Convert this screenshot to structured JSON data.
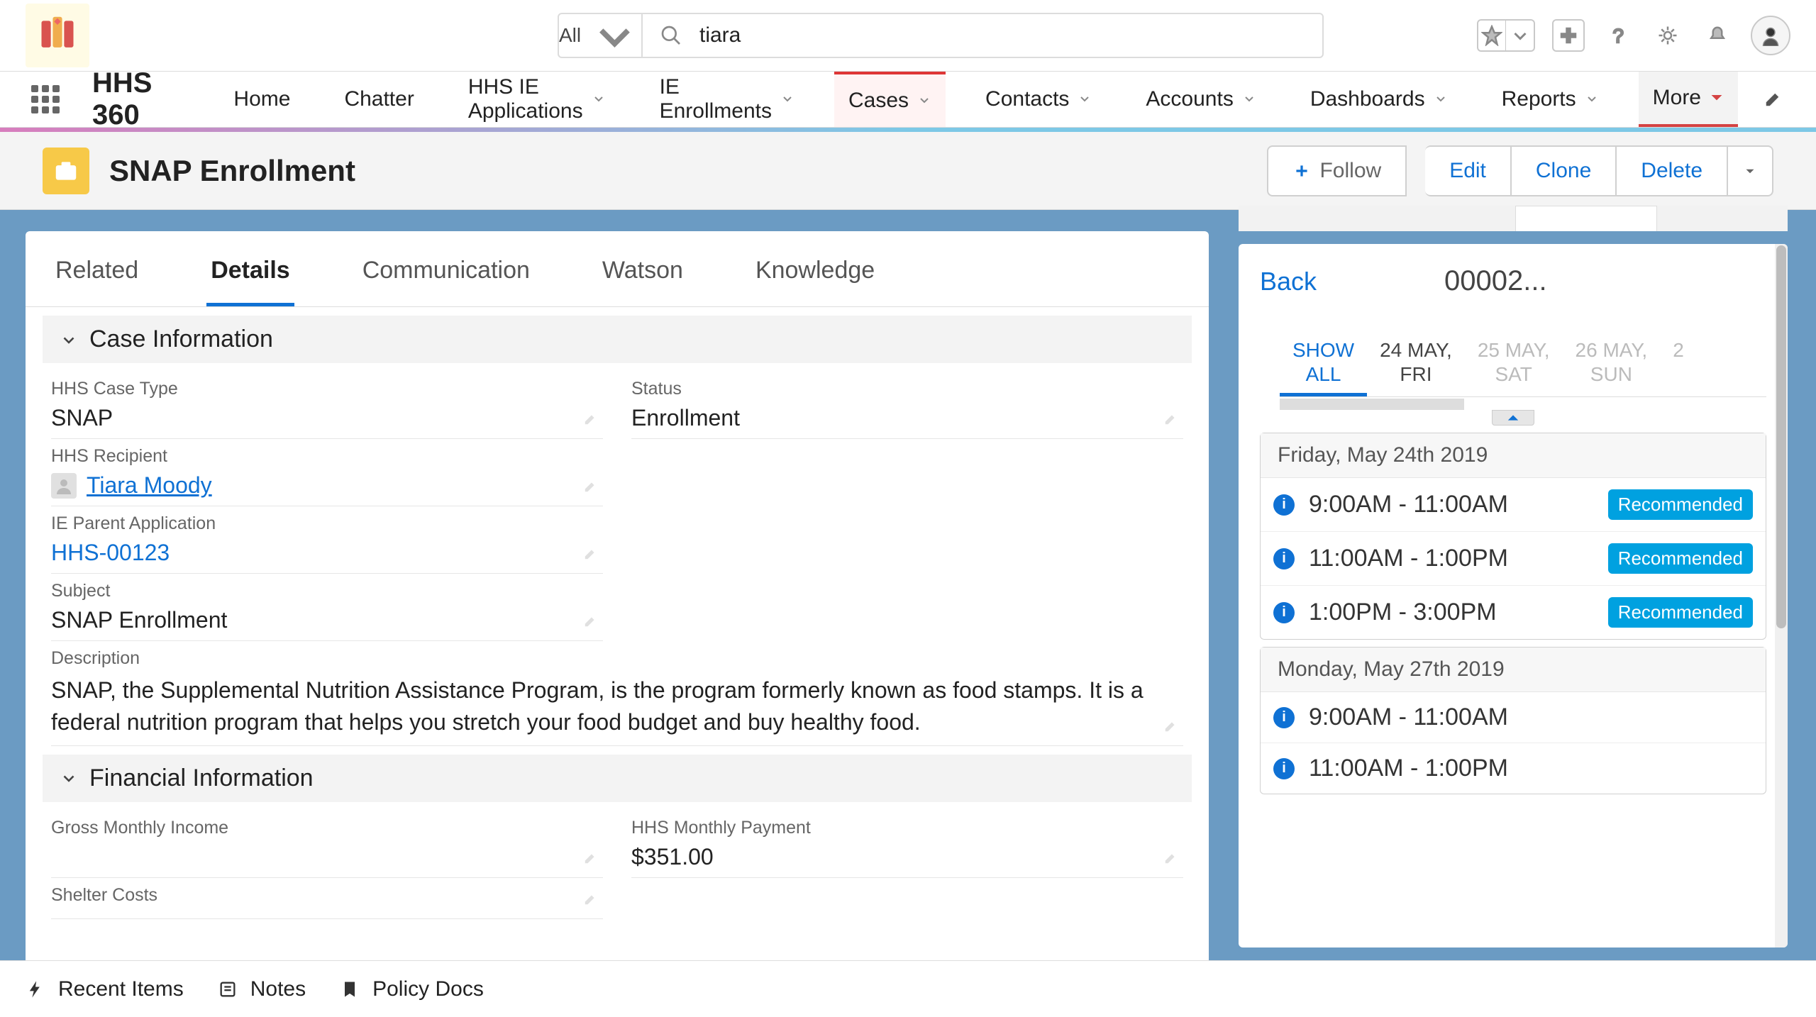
{
  "header": {
    "search_scope": "All",
    "search_value": "tiara"
  },
  "nav": {
    "app_name": "HHS 360",
    "items": [
      "Home",
      "Chatter",
      "HHS IE Applications",
      "IE Enrollments",
      "Cases",
      "Contacts",
      "Accounts",
      "Dashboards",
      "Reports",
      "More"
    ]
  },
  "record": {
    "title": "SNAP Enrollment",
    "actions": {
      "follow": "Follow",
      "edit": "Edit",
      "clone": "Clone",
      "delete": "Delete"
    }
  },
  "tabs": [
    "Related",
    "Details",
    "Communication",
    "Watson",
    "Knowledge"
  ],
  "sections": {
    "case_info_title": "Case Information",
    "financial_title": "Financial Information"
  },
  "fields": {
    "hhs_case_type": {
      "label": "HHS Case Type",
      "value": "SNAP"
    },
    "status": {
      "label": "Status",
      "value": "Enrollment"
    },
    "hhs_recipient": {
      "label": "HHS Recipient",
      "value": "Tiara Moody"
    },
    "ie_parent_app": {
      "label": "IE Parent Application",
      "value": "HHS-00123"
    },
    "subject": {
      "label": "Subject",
      "value": "SNAP Enrollment"
    },
    "description": {
      "label": "Description",
      "value": "SNAP, the Supplemental Nutrition Assistance Program, is the program formerly known as food stamps. It is a federal nutrition program that helps you stretch your food budget and buy healthy food."
    },
    "gross_monthly_income": {
      "label": "Gross Monthly Income",
      "value": ""
    },
    "hhs_monthly_payment": {
      "label": "HHS Monthly Payment",
      "value": "$351.00"
    },
    "shelter_costs": {
      "label": "Shelter Costs",
      "value": ""
    }
  },
  "scheduler": {
    "back": "Back",
    "title": "00002...",
    "show_all": "SHOW\nALL",
    "dates": [
      {
        "top": "24 MAY,",
        "bottom": "FRI",
        "dark": true
      },
      {
        "top": "25 MAY,",
        "bottom": "SAT",
        "dark": false
      },
      {
        "top": "26 MAY,",
        "bottom": "SUN",
        "dark": false
      },
      {
        "top": "2",
        "bottom": "",
        "dark": false
      }
    ],
    "days": [
      {
        "header": "Friday, May 24th 2019",
        "slots": [
          {
            "time": "9:00AM - 11:00AM",
            "badge": "Recommended"
          },
          {
            "time": "11:00AM - 1:00PM",
            "badge": "Recommended"
          },
          {
            "time": "1:00PM - 3:00PM",
            "badge": "Recommended"
          }
        ]
      },
      {
        "header": "Monday, May 27th 2019",
        "slots": [
          {
            "time": "9:00AM - 11:00AM",
            "badge": ""
          },
          {
            "time": "11:00AM - 1:00PM",
            "badge": ""
          }
        ]
      }
    ]
  },
  "footer": {
    "recent": "Recent Items",
    "notes": "Notes",
    "policy": "Policy Docs"
  }
}
